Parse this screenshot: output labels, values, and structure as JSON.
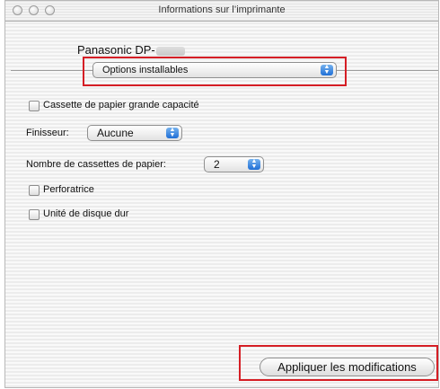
{
  "window": {
    "title": "Informations sur l’imprimante"
  },
  "printer": {
    "name": "Panasonic DP-"
  },
  "section_popup": {
    "selected": "Options installables"
  },
  "options": {
    "high_capacity_tray_label": "Cassette de papier grande capacité",
    "finisher_label": "Finisseur:",
    "finisher_value": "Aucune",
    "cassette_count_label": "Nombre de cassettes de papier:",
    "cassette_count_value": "2",
    "puncher_label": "Perforatrice",
    "hard_disk_label": "Unité de disque dur"
  },
  "actions": {
    "apply_label": "Appliquer les modifications"
  },
  "colors": {
    "highlight": "#d51e25",
    "stepper": "#1f6fd6"
  }
}
